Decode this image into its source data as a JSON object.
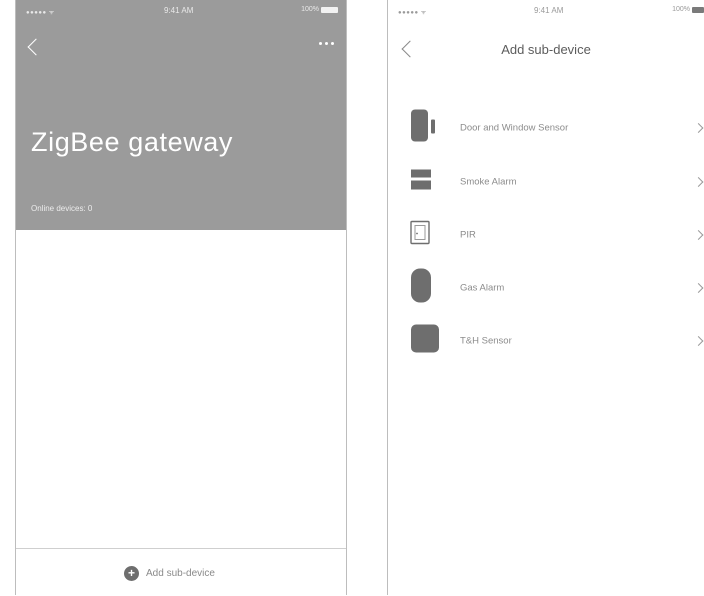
{
  "colors": {
    "header_gray": "#9b9b9b",
    "icon_gray": "#6e6e6e",
    "text_gray": "#8c8c8c"
  },
  "status_bar": {
    "signal": "●●●●● ᯤ",
    "time": "9:41 AM",
    "battery": "100%"
  },
  "gateway_screen": {
    "title": "ZigBee gateway",
    "online_devices": "Online devices: 0",
    "add_button_label": "Add sub-device",
    "back_icon": "chevron-left-icon",
    "more_icon": "more-dots-icon"
  },
  "add_sub_device_screen": {
    "title": "Add sub-device",
    "devices": [
      {
        "label": "Door and Window Sensor",
        "icon": "door-window-sensor-icon"
      },
      {
        "label": "Smoke Alarm",
        "icon": "smoke-alarm-icon"
      },
      {
        "label": "PIR",
        "icon": "pir-sensor-icon"
      },
      {
        "label": "Gas Alarm",
        "icon": "gas-alarm-icon"
      },
      {
        "label": "T&H Sensor",
        "icon": "th-sensor-icon"
      }
    ]
  }
}
